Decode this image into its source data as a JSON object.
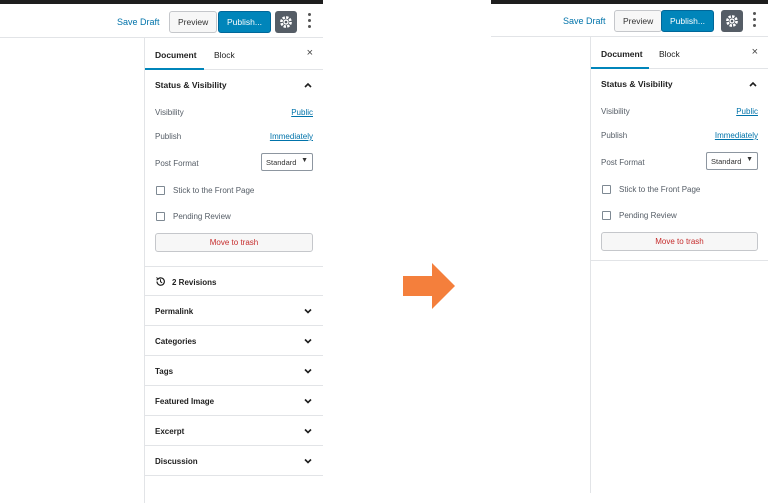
{
  "toolbar": {
    "save_draft": "Save Draft",
    "preview": "Preview",
    "publish": "Publish...",
    "gear_icon": "gear-icon",
    "more_icon": "kebab-menu-icon"
  },
  "sidebar": {
    "tabs": [
      {
        "label": "Document",
        "active": true
      },
      {
        "label": "Block",
        "active": false
      }
    ],
    "close_label": "×",
    "status_visibility": {
      "title": "Status & Visibility",
      "visibility_label": "Visibility",
      "visibility_value": "Public",
      "publish_label": "Publish",
      "publish_value": "Immediately",
      "post_format_label": "Post Format",
      "post_format_value": "Standard",
      "stick_front_page": "Stick to the Front Page",
      "pending_review": "Pending Review",
      "trash_label": "Move to trash"
    },
    "revisions": "2 Revisions",
    "panels": [
      "Permalink",
      "Categories",
      "Tags",
      "Featured Image",
      "Excerpt",
      "Discussion"
    ]
  },
  "colors": {
    "accent": "#0085ba",
    "link": "#0073aa",
    "danger": "#c62d2d",
    "arrow": "#f47f3c"
  }
}
